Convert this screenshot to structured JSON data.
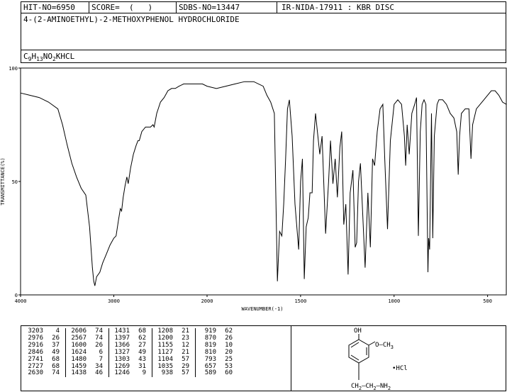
{
  "header": {
    "hit_no": "HIT-NO=6950",
    "score": "SCORE=  (   )",
    "sdbs_no": "SDBS-NO=13447",
    "ir_code": "IR-NIDA-17911 : KBR DISC",
    "compound_name": "4-(2-AMINOETHYL)-2-METHOXYPHENOL HYDROCHLORIDE",
    "formula_parts": [
      "C",
      "9",
      "H",
      "13",
      "NO",
      "2",
      "KHCL"
    ]
  },
  "chart_data": {
    "type": "line",
    "title": "",
    "xlabel": "WAVENUMBER(-1)",
    "ylabel": "TRANSMITTANCE(%)",
    "xlim": [
      4000,
      400
    ],
    "ylim": [
      0,
      100
    ],
    "x_ticks": [
      4000,
      3000,
      2000,
      1500,
      1000,
      500
    ],
    "y_ticks": [
      0,
      50,
      100
    ],
    "x_tick_labels": [
      "4000",
      "3000",
      "2000",
      "1500",
      "1000",
      "500"
    ],
    "y_tick_labels": [
      "0",
      "50",
      "100"
    ],
    "grid": false,
    "series": [
      {
        "values": [
          [
            4000,
            89
          ],
          [
            3900,
            88
          ],
          [
            3800,
            87
          ],
          [
            3700,
            85
          ],
          [
            3600,
            82
          ],
          [
            3550,
            75
          ],
          [
            3500,
            66
          ],
          [
            3450,
            58
          ],
          [
            3400,
            52
          ],
          [
            3350,
            47
          ],
          [
            3300,
            44
          ],
          [
            3260,
            30
          ],
          [
            3230,
            12
          ],
          [
            3215,
            6
          ],
          [
            3203,
            4
          ],
          [
            3185,
            8
          ],
          [
            3150,
            10
          ],
          [
            3120,
            14
          ],
          [
            3080,
            18
          ],
          [
            3040,
            22
          ],
          [
            3000,
            25
          ],
          [
            2976,
            26
          ],
          [
            2950,
            33
          ],
          [
            2930,
            38
          ],
          [
            2916,
            37
          ],
          [
            2900,
            43
          ],
          [
            2880,
            48
          ],
          [
            2860,
            52
          ],
          [
            2846,
            49
          ],
          [
            2820,
            56
          ],
          [
            2790,
            62
          ],
          [
            2760,
            66
          ],
          [
            2741,
            68
          ],
          [
            2727,
            68
          ],
          [
            2700,
            72
          ],
          [
            2660,
            74
          ],
          [
            2630,
            74
          ],
          [
            2606,
            74
          ],
          [
            2580,
            75
          ],
          [
            2567,
            74
          ],
          [
            2540,
            80
          ],
          [
            2500,
            85
          ],
          [
            2460,
            87
          ],
          [
            2420,
            90
          ],
          [
            2380,
            91
          ],
          [
            2340,
            91
          ],
          [
            2300,
            92
          ],
          [
            2250,
            93
          ],
          [
            2200,
            93
          ],
          [
            2150,
            93
          ],
          [
            2100,
            93
          ],
          [
            2050,
            93
          ],
          [
            2000,
            92
          ],
          [
            1950,
            91
          ],
          [
            1900,
            92
          ],
          [
            1850,
            93
          ],
          [
            1800,
            94
          ],
          [
            1750,
            94
          ],
          [
            1700,
            92
          ],
          [
            1680,
            88
          ],
          [
            1660,
            85
          ],
          [
            1640,
            80
          ],
          [
            1624,
            6
          ],
          [
            1612,
            28
          ],
          [
            1600,
            26
          ],
          [
            1590,
            40
          ],
          [
            1580,
            60
          ],
          [
            1570,
            82
          ],
          [
            1560,
            86
          ],
          [
            1545,
            70
          ],
          [
            1530,
            40
          ],
          [
            1520,
            30
          ],
          [
            1510,
            20
          ],
          [
            1500,
            50
          ],
          [
            1490,
            60
          ],
          [
            1480,
            7
          ],
          [
            1470,
            30
          ],
          [
            1459,
            34
          ],
          [
            1450,
            45
          ],
          [
            1438,
            45
          ],
          [
            1431,
            68
          ],
          [
            1420,
            80
          ],
          [
            1410,
            72
          ],
          [
            1397,
            62
          ],
          [
            1385,
            70
          ],
          [
            1366,
            27
          ],
          [
            1350,
            50
          ],
          [
            1340,
            68
          ],
          [
            1327,
            49
          ],
          [
            1315,
            60
          ],
          [
            1303,
            43
          ],
          [
            1290,
            65
          ],
          [
            1280,
            72
          ],
          [
            1269,
            31
          ],
          [
            1258,
            40
          ],
          [
            1246,
            9
          ],
          [
            1235,
            45
          ],
          [
            1220,
            55
          ],
          [
            1208,
            21
          ],
          [
            1200,
            23
          ],
          [
            1190,
            50
          ],
          [
            1180,
            58
          ],
          [
            1170,
            40
          ],
          [
            1155,
            12
          ],
          [
            1140,
            45
          ],
          [
            1127,
            21
          ],
          [
            1115,
            60
          ],
          [
            1104,
            57
          ],
          [
            1090,
            72
          ],
          [
            1075,
            82
          ],
          [
            1060,
            84
          ],
          [
            1050,
            60
          ],
          [
            1035,
            29
          ],
          [
            1020,
            68
          ],
          [
            1000,
            84
          ],
          [
            980,
            86
          ],
          [
            960,
            84
          ],
          [
            945,
            70
          ],
          [
            938,
            57
          ],
          [
            930,
            75
          ],
          [
            919,
            62
          ],
          [
            905,
            80
          ],
          [
            890,
            84
          ],
          [
            880,
            87
          ],
          [
            870,
            26
          ],
          [
            860,
            72
          ],
          [
            850,
            84
          ],
          [
            840,
            86
          ],
          [
            830,
            84
          ],
          [
            819,
            10
          ],
          [
            815,
            25
          ],
          [
            810,
            20
          ],
          [
            800,
            80
          ],
          [
            793,
            25
          ],
          [
            785,
            70
          ],
          [
            770,
            84
          ],
          [
            760,
            86
          ],
          [
            740,
            86
          ],
          [
            720,
            84
          ],
          [
            700,
            80
          ],
          [
            680,
            78
          ],
          [
            665,
            72
          ],
          [
            657,
            53
          ],
          [
            650,
            70
          ],
          [
            640,
            80
          ],
          [
            620,
            82
          ],
          [
            600,
            82
          ],
          [
            595,
            72
          ],
          [
            589,
            60
          ],
          [
            580,
            75
          ],
          [
            560,
            82
          ],
          [
            540,
            84
          ],
          [
            520,
            86
          ],
          [
            500,
            88
          ],
          [
            480,
            90
          ],
          [
            460,
            90
          ],
          [
            440,
            88
          ],
          [
            420,
            85
          ],
          [
            400,
            84
          ]
        ]
      }
    ]
  },
  "peak_table": [
    [
      [
        "3203",
        "4"
      ],
      [
        "2606",
        "74"
      ],
      [
        "1431",
        "68"
      ],
      [
        "1208",
        "21"
      ],
      [
        "919",
        "62"
      ]
    ],
    [
      [
        "2976",
        "26"
      ],
      [
        "2567",
        "74"
      ],
      [
        "1397",
        "62"
      ],
      [
        "1200",
        "23"
      ],
      [
        "870",
        "26"
      ]
    ],
    [
      [
        "2916",
        "37"
      ],
      [
        "1600",
        "26"
      ],
      [
        "1366",
        "27"
      ],
      [
        "1155",
        "12"
      ],
      [
        "819",
        "10"
      ]
    ],
    [
      [
        "2846",
        "49"
      ],
      [
        "1624",
        "6"
      ],
      [
        "1327",
        "49"
      ],
      [
        "1127",
        "21"
      ],
      [
        "810",
        "20"
      ]
    ],
    [
      [
        "2741",
        "68"
      ],
      [
        "1480",
        "7"
      ],
      [
        "1303",
        "43"
      ],
      [
        "1104",
        "57"
      ],
      [
        "793",
        "25"
      ]
    ],
    [
      [
        "2727",
        "68"
      ],
      [
        "1459",
        "34"
      ],
      [
        "1269",
        "31"
      ],
      [
        "1035",
        "29"
      ],
      [
        "657",
        "53"
      ]
    ],
    [
      [
        "2630",
        "74"
      ],
      [
        "1438",
        "46"
      ],
      [
        "1246",
        "9"
      ],
      [
        "938",
        "57"
      ],
      [
        "589",
        "60"
      ]
    ]
  ],
  "structure": {
    "oh": "OH",
    "ome": "O—CH",
    "ome_sub": "3",
    "hcl": "•HCl",
    "chain": "CH",
    "chain_sub": "2",
    "chain_mid": "—CH",
    "chain_sub2": "2",
    "chain_end": "—NH",
    "chain_sub3": "2"
  }
}
